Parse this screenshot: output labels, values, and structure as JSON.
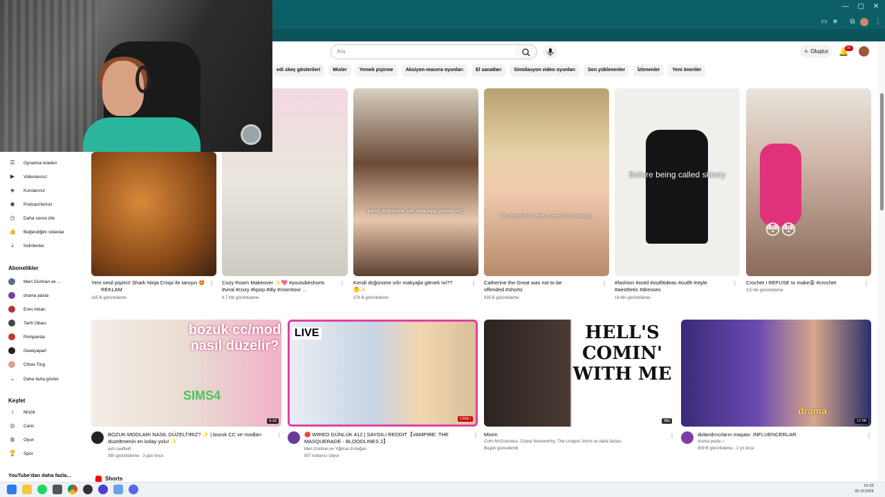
{
  "header": {
    "search_placeholder": "Ara",
    "create_label": "Oluştur",
    "notification_count": "9+"
  },
  "chips": [
    "edi skeç gösterileri",
    "Mixler",
    "Yemek pişirme",
    "Aksiyon-macera oyunları",
    "El sanatları",
    "Simülasyon video oyunları",
    "Son yüklenenler",
    "İzlenenler",
    "Yeni öneriler"
  ],
  "sidebar": {
    "you_items": [
      {
        "label": "Oynatma listeleri",
        "icon": "playlist-icon"
      },
      {
        "label": "Videolarınız",
        "icon": "video-icon"
      },
      {
        "label": "Kurslarınız",
        "icon": "course-icon"
      },
      {
        "label": "Podcast'leriniz",
        "icon": "podcast-icon"
      },
      {
        "label": "Daha sonra izle",
        "icon": "clock-icon"
      },
      {
        "label": "Beğendiğim videolar",
        "icon": "thumbs-up-icon"
      },
      {
        "label": "İndirilenler",
        "icon": "download-icon"
      }
    ],
    "subs_heading": "Abonelikler",
    "subs": [
      {
        "label": "Mert Günhan ve ...",
        "color": "#5a6b8c"
      },
      {
        "label": "drama pasta",
        "color": "#7a3fa0"
      },
      {
        "label": "Eren Aktan",
        "color": "#b03a2e"
      },
      {
        "label": "Tarih Obası",
        "color": "#444444"
      },
      {
        "label": "Pintipanda",
        "color": "#c0392b"
      },
      {
        "label": "Geekyapar!",
        "color": "#222222"
      },
      {
        "label": "Chloe Ting",
        "color": "#d8a48f"
      }
    ],
    "show_more": "Daha fazla göster",
    "explore_heading": "Keşfet",
    "explore": [
      {
        "label": "Müzik",
        "icon": "music-icon"
      },
      {
        "label": "Canlı",
        "icon": "live-icon"
      },
      {
        "label": "Oyun",
        "icon": "gamepad-icon"
      },
      {
        "label": "Spor",
        "icon": "trophy-icon"
      }
    ],
    "more_from": "YouTube'dan daha fazla..."
  },
  "row1": [
    {
      "title": "Yeni nesil pişirici! Shark Ninja Crispi ile tanışın 🤩",
      "line2": "REKLAM",
      "meta": "165 B görüntüleme"
    },
    {
      "title": "Cozy Room Makeover ✨💖 #youtubeshorts",
      "line2": "#viral #cozy #kpop #diy #roomtour ...",
      "meta": "4,7 Mn görüntüleme"
    },
    {
      "title": "Kendi düğününe sıfır makyajla gitmek mi??",
      "line2": "🤔✨",
      "meta": "376 B görüntüleme",
      "overlay": "kendi düğününe sıfır makyajla gitmek mi?"
    },
    {
      "title": "Catherine the Great was not to be",
      "line2": "offended.#shorts",
      "meta": "935 B görüntüleme",
      "overlay": "No more shall we be a one-church country."
    },
    {
      "title": "#fashion #ootd #outfitideas #outfit #style",
      "line2": "#aesthetic #dresses",
      "meta": "18 Mn görüntüleme",
      "overlay": "Before being called skinny"
    },
    {
      "title": "Crochet I REFUSE to make😫 #crochet",
      "line2": "",
      "meta": "3,5 Mn görüntüleme",
      "overlay": "😳😳"
    }
  ],
  "row2": [
    {
      "title": "BOZUK MODLARI NASIL DÜZELTİRİZ? ✨ | bozuk CC ve modları",
      "line2": "düzeltmenin en kolay yolu! ✨",
      "channel": "ash caulfield",
      "meta": "380 görüntüleme · 3 gün önce",
      "duration": "6:18",
      "thumb_text": "bozuk cc/mod nasıl düzelir?",
      "sims_label": "SIMS4"
    },
    {
      "title": "🔴 WIRED GÜNLÜK 412 | SAYGILI REDDIT【VAMPIRE: THE",
      "line2": "MASQUERADE - BLOODLINES 2】",
      "channel": "Mert Günhan ve Yiğitcan Erdoğan",
      "meta": "907 kullanıcı izliyor",
      "duration": "CANLI",
      "thumb_text": "LIVE"
    },
    {
      "title": "Mixim",
      "line2": "",
      "channel": "Colm McGuinness, Chase Noseworthy, The Longest Johns ve daha fazlası",
      "meta": "Bugün güncellendi",
      "duration": "Mix",
      "thumb_text": "HELL'S COMIN' WITH ME"
    },
    {
      "title": "dolandırıcıların maşası: INFLUENCERLAR",
      "line2": "",
      "channel": "drama pasta ✓",
      "meta": "809 B görüntüleme · 2 yıl önce",
      "duration": "17:08",
      "thumb_text": "drama"
    }
  ],
  "shorts_label": "Shorts",
  "clock": {
    "time": "01:33",
    "date": "28.10.2025"
  }
}
